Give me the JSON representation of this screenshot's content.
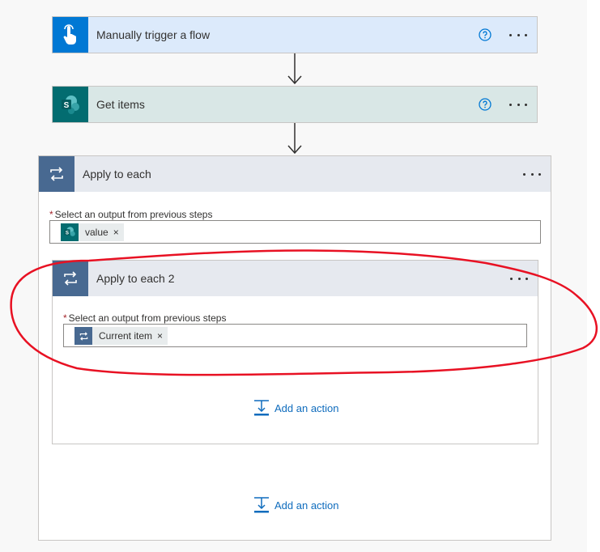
{
  "steps": {
    "trigger": {
      "title": "Manually trigger a flow",
      "icon": "touch-hand-icon",
      "color": "#0078d4",
      "bg": "#dceafb"
    },
    "get_items": {
      "title": "Get items",
      "icon": "sharepoint-icon",
      "color": "#036c70",
      "bg": "#d9e7e6"
    }
  },
  "apply_each": {
    "title": "Apply to each",
    "icon": "loop-icon",
    "field_label": "Select an output from previous steps",
    "token": {
      "label": "value",
      "remove": "×",
      "icon": "sharepoint-icon"
    },
    "add_action": "Add an action"
  },
  "apply_each_2": {
    "title": "Apply to each 2",
    "icon": "loop-icon",
    "field_label": "Select an output from previous steps",
    "token": {
      "label": "Current item",
      "remove": "×",
      "icon": "loop-icon"
    },
    "add_action": "Add an action"
  },
  "required_marker": "*",
  "colors": {
    "loop": "#486991",
    "accent": "#0f6cbd",
    "annotation": "#e81123"
  }
}
